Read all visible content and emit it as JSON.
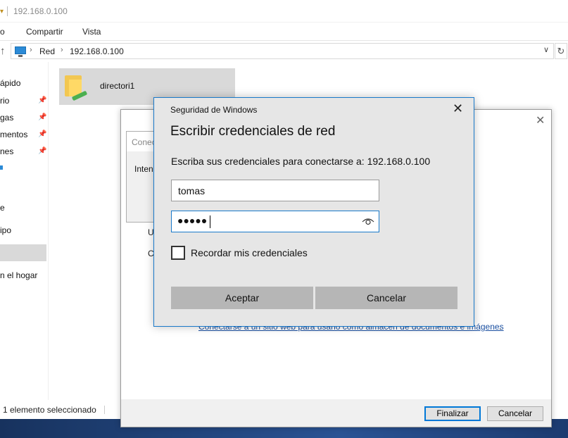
{
  "window": {
    "title": "192.168.0.100"
  },
  "ribbon": {
    "tabs": [
      "o",
      "Compartir",
      "Vista"
    ]
  },
  "address": {
    "crumbs": [
      "Red",
      "192.168.0.100"
    ]
  },
  "navpane": {
    "items": [
      {
        "label": "ápido",
        "pinned": false
      },
      {
        "label": "rio",
        "pinned": true
      },
      {
        "label": "gas",
        "pinned": true
      },
      {
        "label": "mentos",
        "pinned": true
      },
      {
        "label": "nes",
        "pinned": true
      },
      {
        "label": "e",
        "pinned": false
      },
      {
        "label": "ipo",
        "pinned": false
      },
      {
        "label": "n el hogar",
        "pinned": false
      }
    ]
  },
  "content": {
    "items": [
      {
        "name": "directori1",
        "icon": "network-folder-icon",
        "selected": true
      }
    ]
  },
  "status": {
    "text": "1 elemento seleccionado"
  },
  "wizard": {
    "letter_u": "U",
    "letter_c": "C",
    "link_text": "Conectarse a un sitio web para usarlo como almacén de documentos e imágenes",
    "link_suffix": ".",
    "finish_label": "Finalizar",
    "cancel_label": "Cancelar"
  },
  "mini_dialog": {
    "title": "Conec",
    "text": "Inten"
  },
  "credentials": {
    "caption": "Seguridad de Windows",
    "heading": "Escribir credenciales de red",
    "prompt": "Escriba sus credenciales para conectarse a: 192.168.0.100",
    "username": "tomas",
    "password_mask": "●●●●●",
    "remember_label": "Recordar mis credenciales",
    "remember_checked": false,
    "accept_label": "Aceptar",
    "cancel_label": "Cancelar"
  },
  "colors": {
    "accent": "#1979ca",
    "button_gray": "#b6b6b6",
    "dialog_bg": "#e6e6e6",
    "selection": "#d9d9d9"
  }
}
